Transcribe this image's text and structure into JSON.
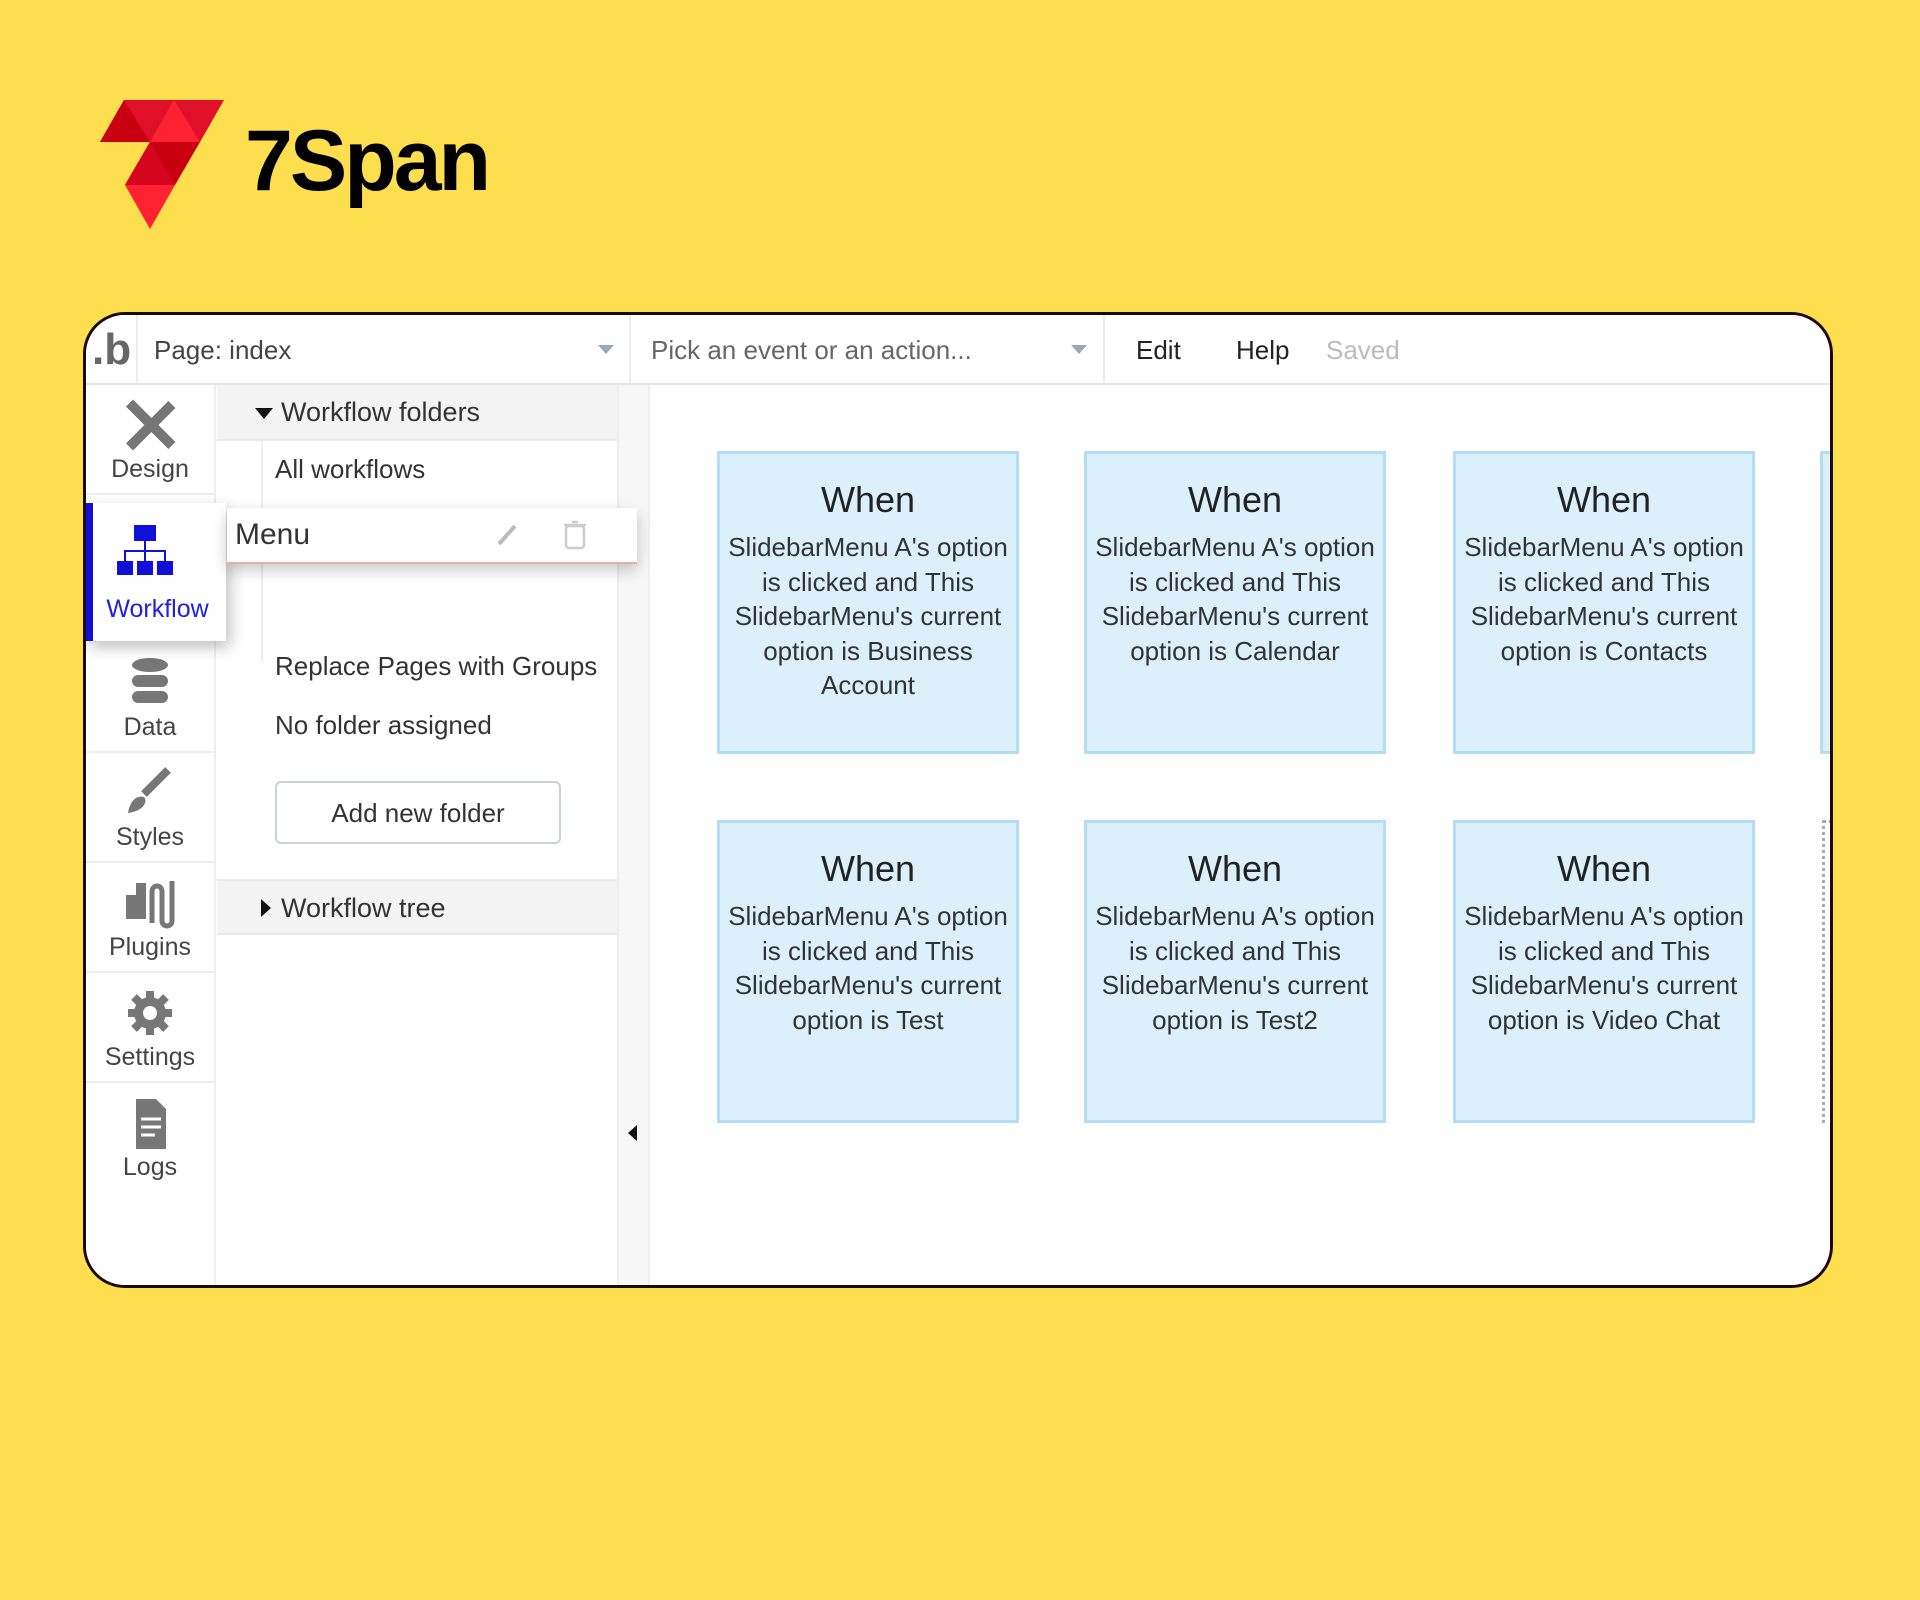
{
  "brand": {
    "name": "7Span",
    "logo_colors": [
      "#C8000F",
      "#E0102A",
      "#FF2233"
    ]
  },
  "topbar": {
    "logo_glyph": ".b",
    "page_selector": "Page: index",
    "event_picker_placeholder": "Pick an event or an action...",
    "edit": "Edit",
    "help": "Help",
    "status": "Saved"
  },
  "sidebar": {
    "items": [
      {
        "label": "Design",
        "icon": "design-tools-icon"
      },
      {
        "label": "Workflow",
        "icon": "workflow-tree-icon",
        "active": true
      },
      {
        "label": "Data",
        "icon": "database-icon"
      },
      {
        "label": "Styles",
        "icon": "brush-icon"
      },
      {
        "label": "Plugins",
        "icon": "plug-icon"
      },
      {
        "label": "Settings",
        "icon": "gear-icon"
      },
      {
        "label": "Logs",
        "icon": "document-icon"
      }
    ],
    "accent": "#1010D8"
  },
  "panel": {
    "folders_header": "Workflow folders",
    "items": [
      "All workflows",
      "Menu",
      "Replace Pages with Groups",
      "No folder assigned"
    ],
    "add_folder": "Add new folder",
    "tree_header": "Workflow tree"
  },
  "cards": [
    {
      "title": "When",
      "body": "SlidebarMenu A's option is clicked and This SlidebarMenu's current option is Business Account"
    },
    {
      "title": "When",
      "body": "SlidebarMenu A's option is clicked and This SlidebarMenu's current option is Calendar"
    },
    {
      "title": "When",
      "body": "SlidebarMenu A's option is clicked and This SlidebarMenu's current option is Contacts"
    },
    {
      "title": "When",
      "body": "SlidebarMenu A's option is clicked and This SlidebarMenu's current option is Test"
    },
    {
      "title": "When",
      "body": "SlidebarMenu A's option is clicked and This SlidebarMenu's current option is Test2"
    },
    {
      "title": "When",
      "body": "SlidebarMenu A's option is clicked and This SlidebarMenu's current option is Video Chat"
    }
  ],
  "colors": {
    "background": "#FDDE4F",
    "card_bg": "#DCF0FC",
    "card_border": "#B3DDF6"
  }
}
